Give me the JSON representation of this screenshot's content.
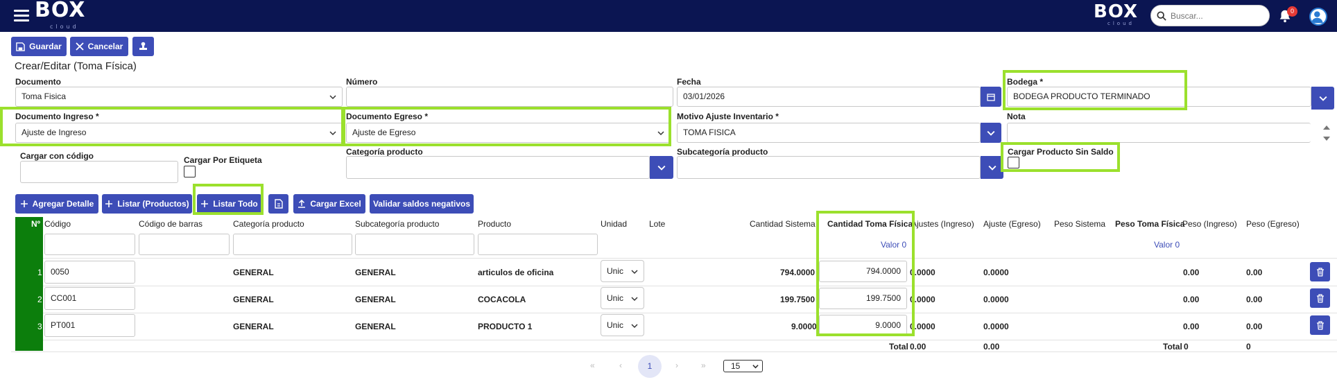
{
  "topbar": {
    "logo_left": "BOX",
    "logo_left_sub": "cloud",
    "logo_right": "BOX",
    "logo_right_sub": "cloud",
    "search_placeholder": "Buscar...",
    "notification_count": "0"
  },
  "toolbar": {
    "save_label": "Guardar",
    "cancel_label": "Cancelar"
  },
  "page_title": "Crear/Editar (Toma Física)",
  "form": {
    "documento_label": "Documento",
    "documento_value": "Toma Fisica",
    "numero_label": "Número",
    "numero_value": "",
    "fecha_label": "Fecha",
    "fecha_value": "03/01/2026",
    "bodega_label": "Bodega",
    "bodega_value": "BODEGA PRODUCTO TERMINADO",
    "doc_ingreso_label": "Documento Ingreso",
    "doc_ingreso_value": "Ajuste de Ingreso",
    "doc_egreso_label": "Documento Egreso",
    "doc_egreso_value": "Ajuste de Egreso",
    "motivo_label": "Motivo Ajuste Inventario",
    "motivo_value": "TOMA FISICA",
    "nota_label": "Nota",
    "nota_value": "",
    "cargar_codigo_label": "Cargar con código",
    "cargar_etiqueta_label": "Cargar Por Etiqueta",
    "categoria_label": "Categoría producto",
    "subcategoria_label": "Subcategoría producto",
    "sin_saldo_label": "Cargar Producto Sin Saldo",
    "required_mark": "*"
  },
  "actions": {
    "agregar_detalle": "Agregar Detalle",
    "listar_productos": "Listar (Productos)",
    "listar_todo": "Listar Todo",
    "cargar_excel": "Cargar Excel",
    "validar": "Validar saldos negativos"
  },
  "table": {
    "headers": {
      "n": "Nº",
      "codigo": "Código",
      "codigo_barras": "Código de barras",
      "categoria": "Categoría producto",
      "subcategoria": "Subcategoría producto",
      "producto": "Producto",
      "unidad": "Unidad",
      "lote": "Lote",
      "cantidad_sistema": "Cantidad Sistema",
      "cantidad_toma": "Cantidad Toma Física",
      "ajustes_ingreso": "Ajustes (Ingreso)",
      "ajuste_egreso": "Ajuste (Egreso)",
      "peso_sistema": "Peso Sistema",
      "peso_toma": "Peso Toma Física",
      "peso_ingreso": "Peso (Ingreso)",
      "peso_egreso": "Peso (Egreso)"
    },
    "valor_cantidad": "Valor 0",
    "valor_peso": "Valor 0",
    "rows": [
      {
        "n": "1",
        "codigo": "0050",
        "categoria": "GENERAL",
        "subcategoria": "GENERAL",
        "producto": "articulos de oficina",
        "unidad": "Unic",
        "cant_sistema": "794.0000",
        "cant_toma": "794.0000",
        "aj_ingreso": "0.0000",
        "aj_egreso": "0.0000",
        "peso_ingreso": "0.00",
        "peso_egreso": "0.00"
      },
      {
        "n": "2",
        "codigo": "CC001",
        "categoria": "GENERAL",
        "subcategoria": "GENERAL",
        "producto": "COCACOLA",
        "unidad": "Unic",
        "cant_sistema": "199.7500",
        "cant_toma": "199.7500",
        "aj_ingreso": "0.0000",
        "aj_egreso": "0.0000",
        "peso_ingreso": "0.00",
        "peso_egreso": "0.00"
      },
      {
        "n": "3",
        "codigo": "PT001",
        "categoria": "GENERAL",
        "subcategoria": "GENERAL",
        "producto": "PRODUCTO 1",
        "unidad": "Unic",
        "cant_sistema": "9.0000",
        "cant_toma": "9.0000",
        "aj_ingreso": "0.0000",
        "aj_egreso": "0.0000",
        "peso_ingreso": "0.00",
        "peso_egreso": "0.00"
      }
    ],
    "total_label_1": "Total",
    "total_ingreso": "0.00",
    "total_egreso": "0.00",
    "total_label_2": "Total",
    "total_peso_ingreso": "0",
    "total_peso_egreso": "0"
  },
  "pagination": {
    "current_page": "1",
    "page_size": "15"
  },
  "colors": {
    "topbar": "#0b1552",
    "button": "#3d4db7",
    "highlight": "#9be02d",
    "row_marker": "#0c7e0c"
  }
}
